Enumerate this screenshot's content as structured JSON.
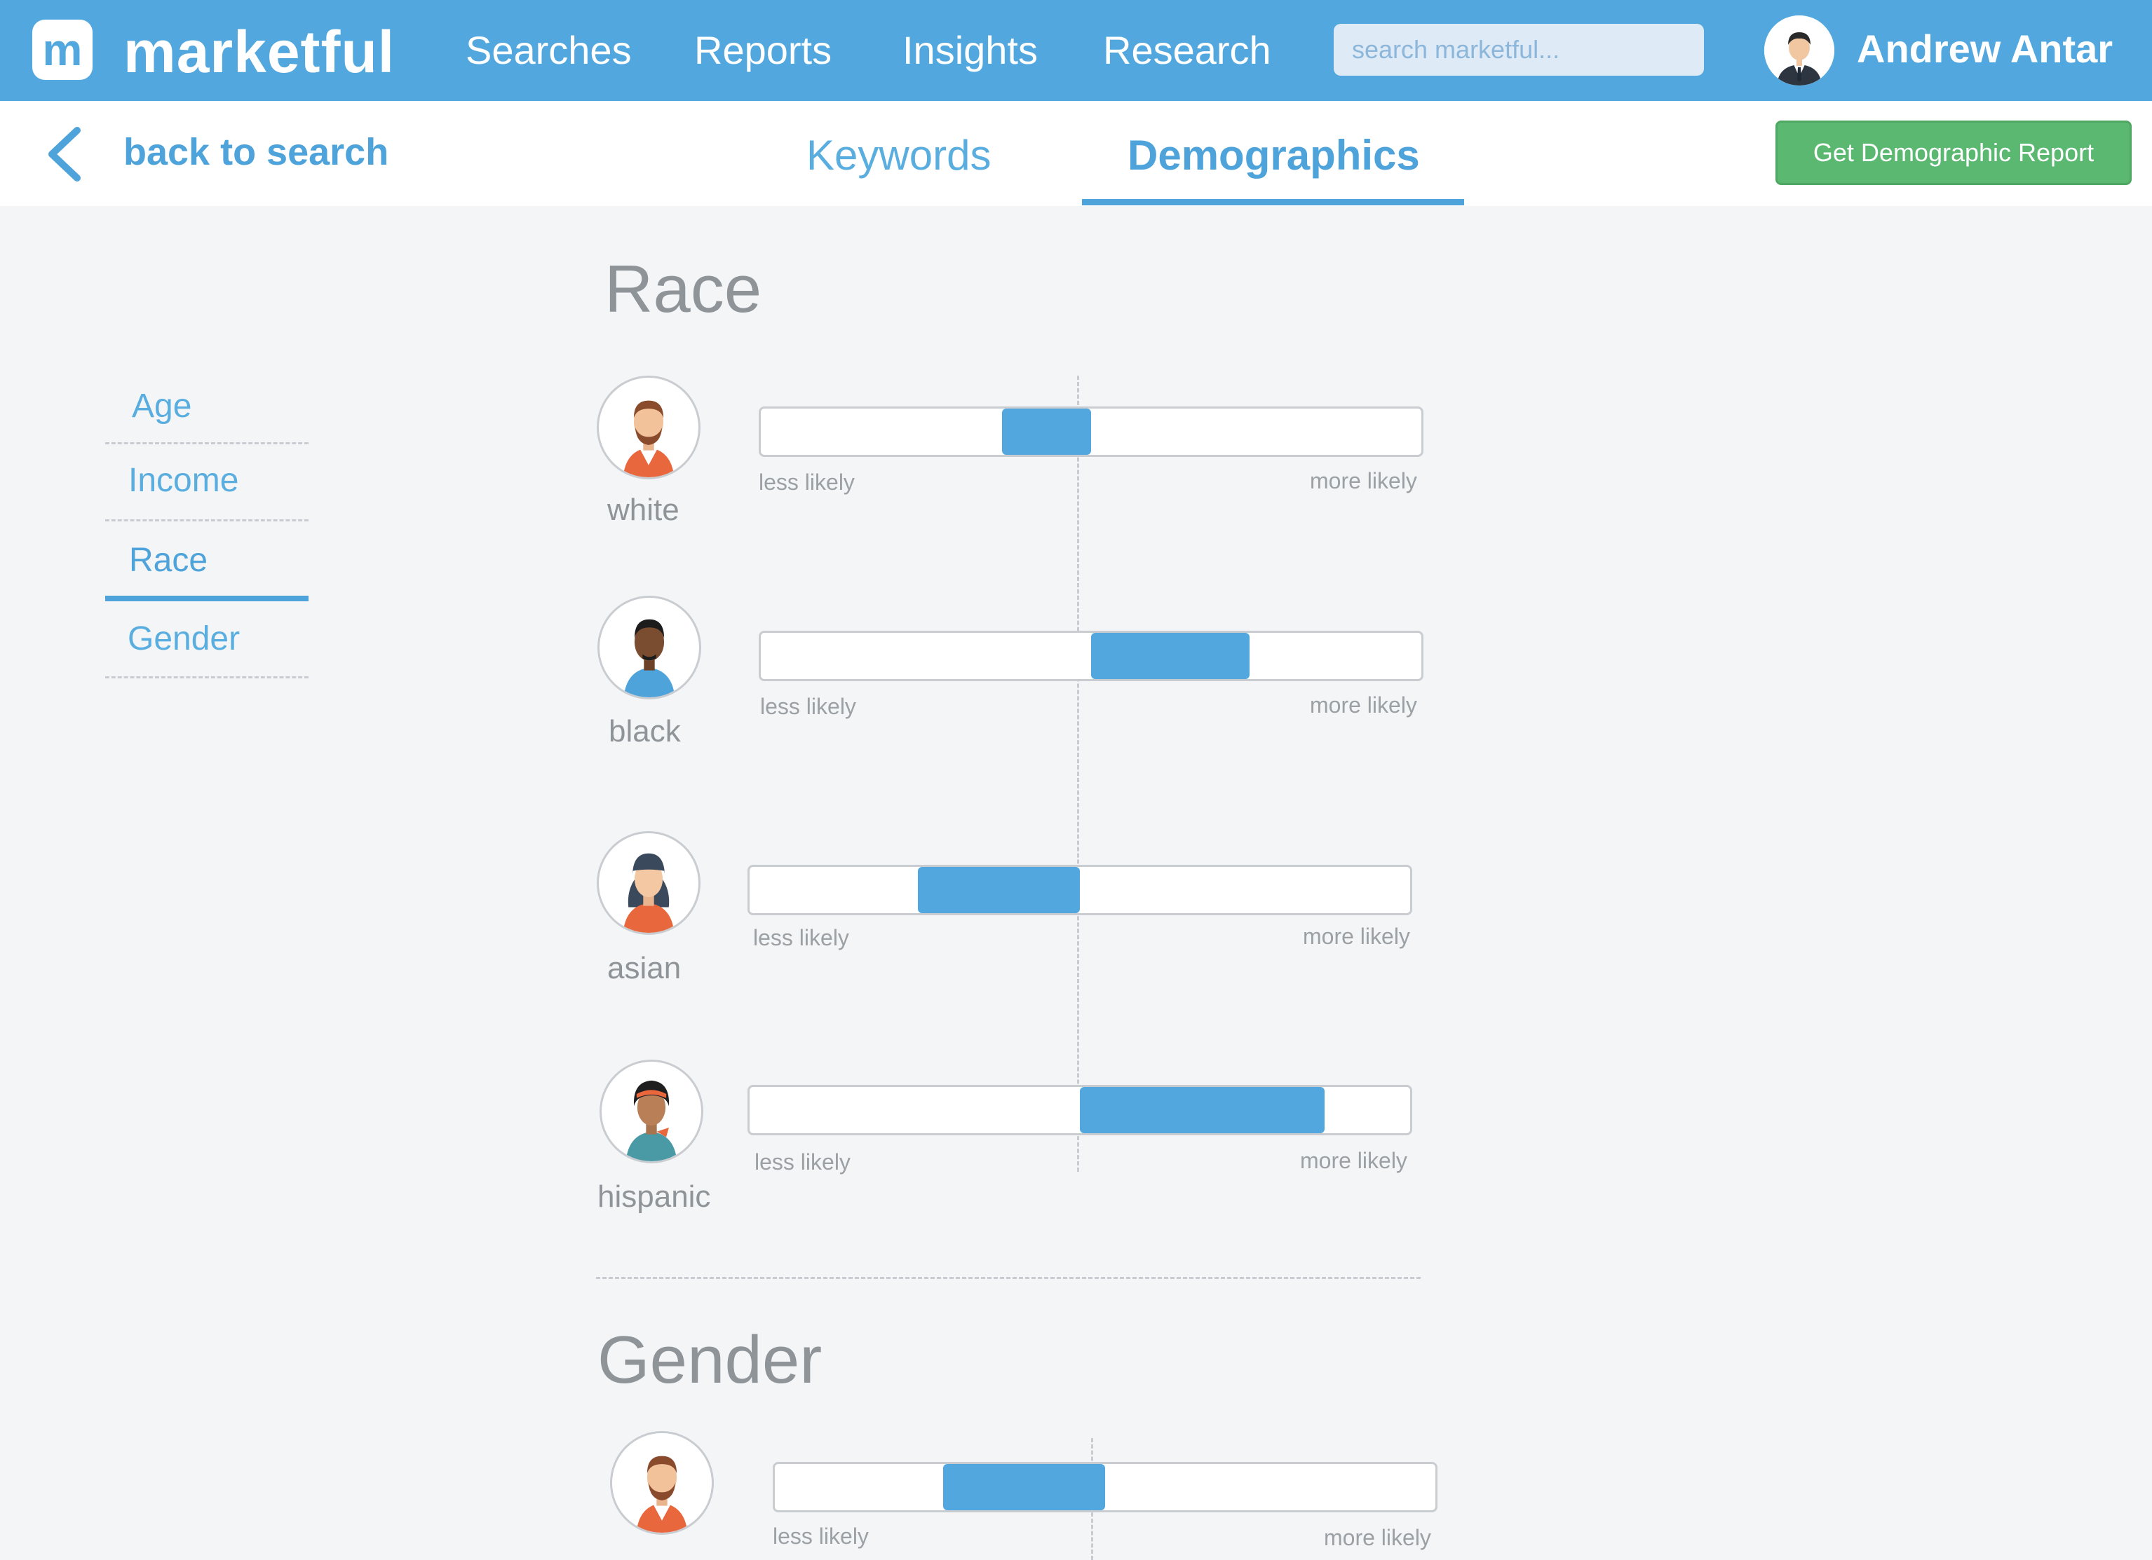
{
  "app": {
    "brand": "marketful",
    "logo_letter": "m",
    "nav": [
      "Searches",
      "Reports",
      "Insights",
      "Research"
    ],
    "search_placeholder": "search marketful...",
    "user_name": "Andrew Antar"
  },
  "subheader": {
    "back_label": "back to search",
    "tabs": [
      "Keywords",
      "Demographics"
    ],
    "active_tab": "Demographics",
    "report_button": "Get Demographic Report"
  },
  "sidebar": {
    "items": [
      "Age",
      "Income",
      "Race",
      "Gender"
    ],
    "active": "Race"
  },
  "scale": {
    "less": "less likely",
    "more": "more likely"
  },
  "sections": {
    "race": {
      "title": "Race",
      "rows": [
        {
          "label": "white",
          "from": -0.27,
          "to": 0.0
        },
        {
          "label": "black",
          "from": 0.0,
          "to": 0.48
        },
        {
          "label": "asian",
          "from": -0.49,
          "to": 0.0
        },
        {
          "label": "hispanic",
          "from": 0.0,
          "to": 0.74
        }
      ]
    },
    "gender": {
      "title": "Gender",
      "rows": [
        {
          "label": "",
          "from": -0.49,
          "to": 0.0
        }
      ]
    }
  },
  "colors": {
    "primary": "#52a8de",
    "report_button": "#5bb870",
    "text_muted": "#8f9499"
  }
}
